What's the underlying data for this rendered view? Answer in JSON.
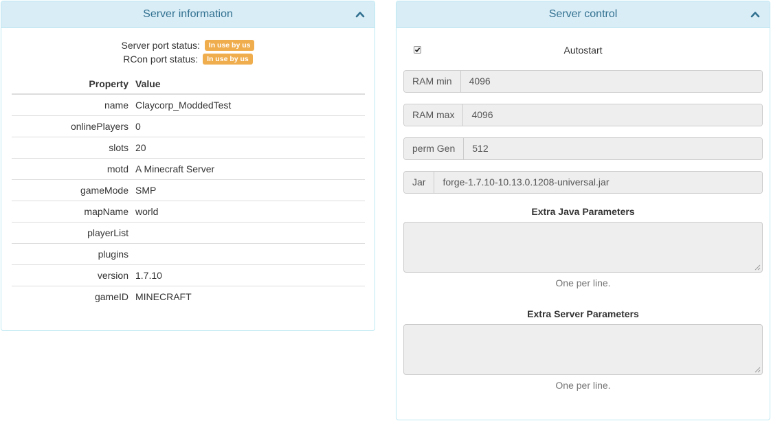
{
  "info_panel": {
    "title": "Server information",
    "server_port_label": "Server port status:",
    "server_port_badge": "In use by us",
    "rcon_port_label": "RCon port status:",
    "rcon_port_badge": "In use by us",
    "columns": [
      "Property",
      "Value"
    ],
    "rows": [
      {
        "key": "name",
        "value": "Claycorp_ModdedTest"
      },
      {
        "key": "onlinePlayers",
        "value": "0"
      },
      {
        "key": "slots",
        "value": "20"
      },
      {
        "key": "motd",
        "value": "A Minecraft Server"
      },
      {
        "key": "gameMode",
        "value": "SMP"
      },
      {
        "key": "mapName",
        "value": "world"
      },
      {
        "key": "playerList",
        "value": ""
      },
      {
        "key": "plugins",
        "value": ""
      },
      {
        "key": "version",
        "value": "1.7.10"
      },
      {
        "key": "gameID",
        "value": "MINECRAFT"
      }
    ]
  },
  "control_panel": {
    "title": "Server control",
    "autostart_label": "Autostart",
    "autostart_checked": true,
    "ram_min_label": "RAM min",
    "ram_min_value": "4096",
    "ram_max_label": "RAM max",
    "ram_max_value": "4096",
    "perm_gen_label": "perm Gen",
    "perm_gen_value": "512",
    "jar_label": "Jar",
    "jar_value": "forge-1.7.10-10.13.0.1208-universal.jar",
    "extra_java_title": "Extra Java Parameters",
    "extra_java_value": "",
    "extra_java_help": "One per line.",
    "extra_server_title": "Extra Server Parameters",
    "extra_server_value": "",
    "extra_server_help": "One per line."
  },
  "colors": {
    "heading_bg": "#d9edf7",
    "heading_text": "#31708f",
    "panel_border": "#bce8f1",
    "badge_warning": "#f0ad4e",
    "readonly_bg": "#eeeeee"
  }
}
